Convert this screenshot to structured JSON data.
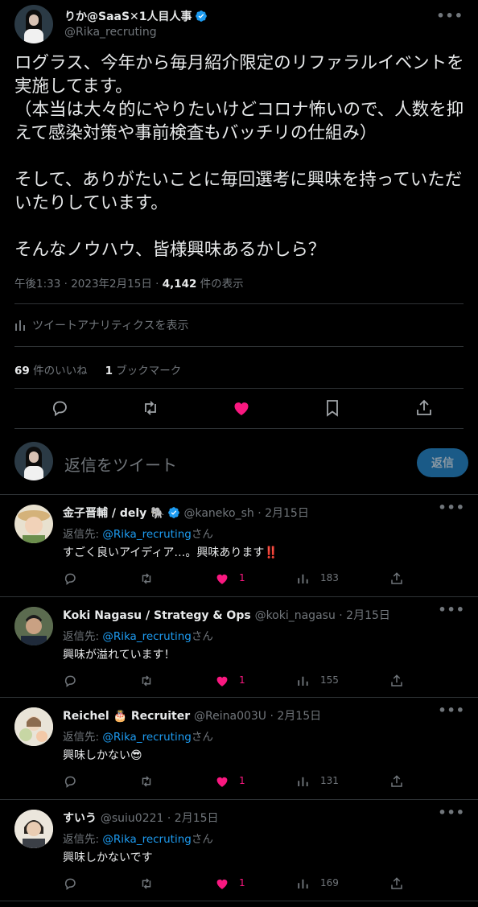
{
  "main": {
    "display_name": "りか@SaaS✕1人目人事",
    "handle": "@Rika_recruting",
    "text": "ログラス、今年から毎月紹介限定のリファラルイベントを実施してます。\n（本当は大々的にやりたいけどコロナ怖いので、人数を抑えて感染対策や事前検査もバッチリの仕組み）\n\nそして、ありがたいことに毎回選考に興味を持っていただいたりしています。\n\nそんなノウハウ、皆様興味あるかしら？",
    "timestamp": "午後1:33 · 2023年2月15日 · ",
    "views_count": "4,142",
    "views_label": " 件の表示",
    "analytics_label": "ツイートアナリティクスを表示",
    "likes_count": "69",
    "likes_label": " 件のいいね",
    "bookmarks_count": "1",
    "bookmarks_label": " ブックマーク"
  },
  "reply_box": {
    "placeholder": "返信をツイート",
    "button_label": "返信"
  },
  "replies": [
    {
      "name": "金子晋輔 / dely 🐘",
      "verified": true,
      "handle_date": "@kaneko_sh · 2月15日",
      "to_prefix": "返信先: ",
      "to_handle": "@Rika_recruting",
      "to_suffix": "さん",
      "text": "すごく良いアイディア…。興味あります‼️",
      "likes": "1",
      "views": "183"
    },
    {
      "name": "Koki Nagasu / Strategy & Ops",
      "verified": false,
      "handle_date": "@koki_nagasu · 2月15日",
      "to_prefix": "返信先: ",
      "to_handle": "@Rika_recruting",
      "to_suffix": "さん",
      "text": "興味が溢れています！",
      "likes": "1",
      "views": "155"
    },
    {
      "name": "Reichel 🎂 Recruiter",
      "verified": false,
      "handle_date": "@Reina003U · 2月15日",
      "to_prefix": "返信先: ",
      "to_handle": "@Rika_recruting",
      "to_suffix": "さん",
      "text": "興味しかない😎",
      "likes": "1",
      "views": "131"
    },
    {
      "name": "すいう",
      "verified": false,
      "handle_date": "@suiu0221 · 2月15日",
      "to_prefix": "返信先: ",
      "to_handle": "@Rika_recruting",
      "to_suffix": "さん",
      "text": "興味しかないです",
      "likes": "1",
      "views": "169"
    }
  ],
  "colors": {
    "background": "#000000",
    "text": "#e7e9ea",
    "secondary": "#71767b",
    "link": "#1d9bf0",
    "like": "#f91880",
    "divider": "#2f3336"
  }
}
